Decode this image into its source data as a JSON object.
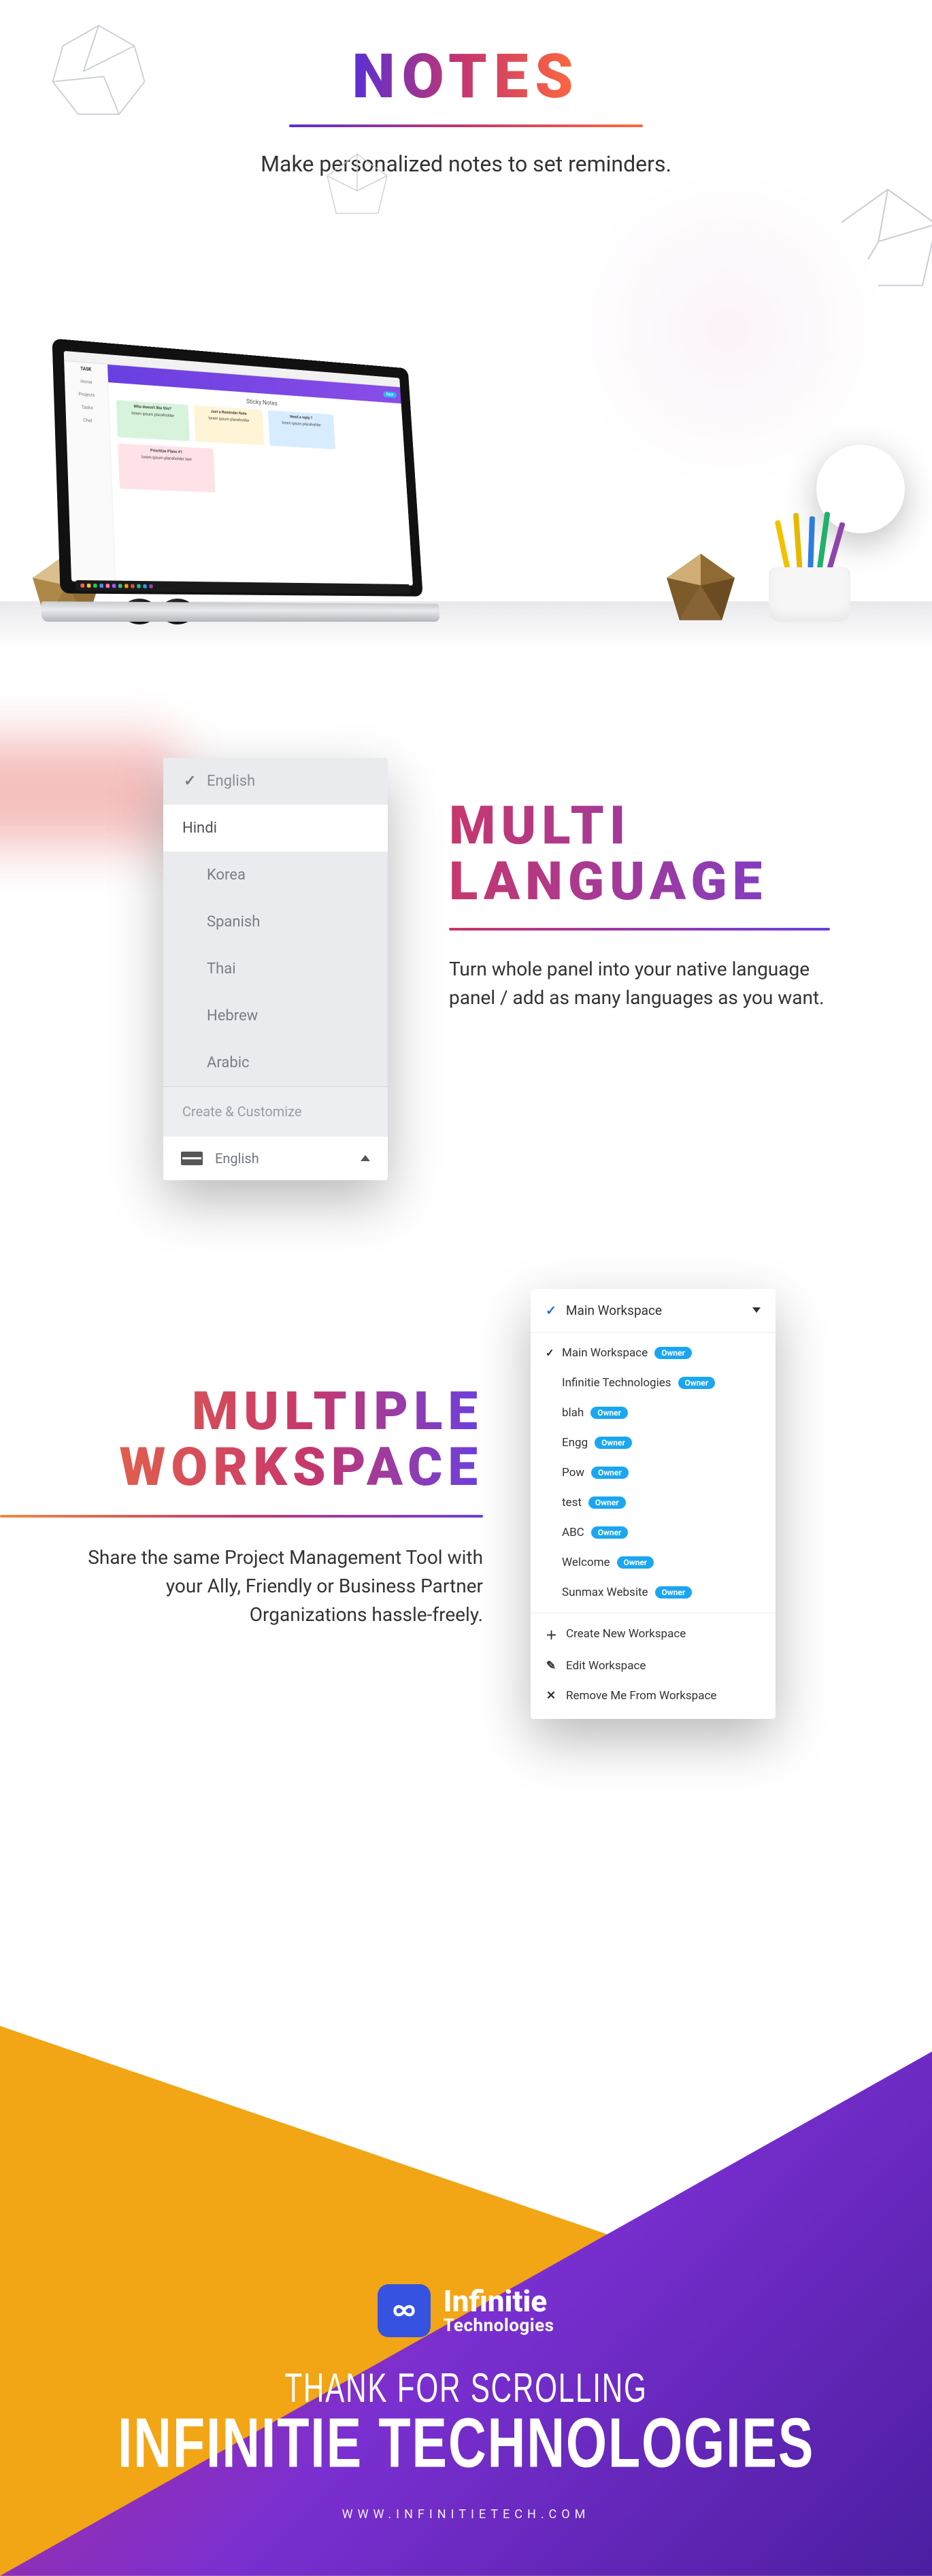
{
  "notes": {
    "title": "NOTES",
    "subtitle": "Make personalized notes to set reminders.",
    "app": {
      "logo": "TASK",
      "sidebar": [
        "Home",
        "Projects",
        "Tasks",
        "Chat"
      ],
      "header_pill": "New",
      "page_title": "Sticky Notes",
      "cards": [
        {
          "title": "Who doesn't like this?",
          "body": "lorem ipsum placeholder"
        },
        {
          "title": "Just a Reminder Note",
          "body": "lorem ipsum placeholder"
        },
        {
          "title": "Need a reply ?",
          "body": "lorem ipsum placeholder"
        }
      ],
      "card_big": {
        "title": "Prioritize Plans #1",
        "body": "lorem ipsum placeholder text"
      }
    }
  },
  "lang": {
    "title_l1": "MULTI",
    "title_l2": "LANGUAGE",
    "body": "Turn whole panel into your native language panel / add as many languages as you want.",
    "items": [
      "English",
      "Hindi",
      "Korea",
      "Spanish",
      "Thai",
      "Hebrew",
      "Arabic"
    ],
    "create": "Create & Customize",
    "footer_label": "English"
  },
  "ws": {
    "title_l1": "MULTIPLE",
    "title_l2": "WORKSPACE",
    "body": "Share the same Project Management Tool with your Ally, Friendly or Business Partner Organizations hassle-freely.",
    "header": "Main Workspace",
    "badge": "Owner",
    "items": [
      {
        "name": "Main Workspace",
        "checked": true
      },
      {
        "name": "Infinitie Technologies",
        "checked": false
      },
      {
        "name": "blah",
        "checked": false
      },
      {
        "name": "Engg",
        "checked": false
      },
      {
        "name": "Pow",
        "checked": false
      },
      {
        "name": "test",
        "checked": false
      },
      {
        "name": "ABC",
        "checked": false
      },
      {
        "name": "Welcome",
        "checked": false
      },
      {
        "name": "Sunmax Website",
        "checked": false
      }
    ],
    "actions": {
      "create": "Create New Workspace",
      "edit": "Edit Workspace",
      "remove": "Remove Me From Workspace"
    }
  },
  "footer": {
    "brand_l1": "Infinitie",
    "brand_l2": "Technologies",
    "thanks": "THANK FOR SCROLLING",
    "company": "INFINITIE TECHNOLOGIES",
    "url": "WWW.INFINITIETECH.COM"
  }
}
